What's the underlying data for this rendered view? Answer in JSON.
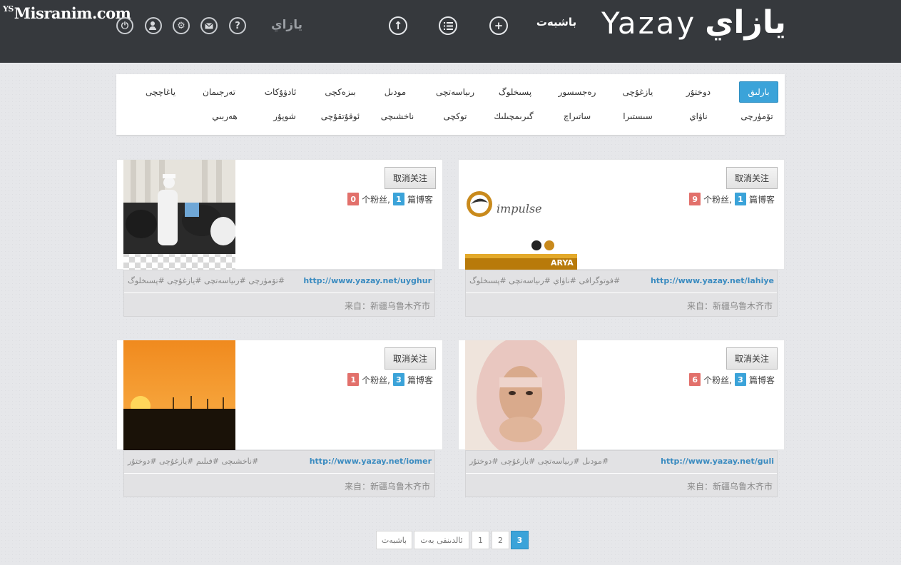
{
  "watermark": {
    "cap": "YS",
    "text": "Misranim.com"
  },
  "header": {
    "logo_uyghur": "يازاي",
    "logo_latin": "Yazay",
    "home_link": "باشبەت",
    "user_name": "يازاي",
    "icons": [
      "power-icon",
      "add-user-icon",
      "settings-icon",
      "mail-icon",
      "help-icon",
      "upload-icon",
      "list-icon",
      "plus-icon"
    ]
  },
  "categories": [
    {
      "label": "بارلىق",
      "active": true
    },
    {
      "label": "دوختۇر"
    },
    {
      "label": "يازغۇچى"
    },
    {
      "label": "رەجسسور"
    },
    {
      "label": "پسىخلوگ"
    },
    {
      "label": "رىياسەتچى"
    },
    {
      "label": "مودىل"
    },
    {
      "label": "بىزەكچى"
    },
    {
      "label": "ئادۋۇكات"
    },
    {
      "label": "تەرجىمان"
    },
    {
      "label": "ياغاچچى"
    },
    {
      "label": "تۆمۈرچى"
    },
    {
      "label": "ناۋاي"
    },
    {
      "label": "سىستىرا"
    },
    {
      "label": "ساتىراچ"
    },
    {
      "label": "گىرىمچىلىك"
    },
    {
      "label": "توكچى"
    },
    {
      "label": "ناخشىچى"
    },
    {
      "label": "ئوقۇتقۇچى"
    },
    {
      "label": "شوپۇر"
    },
    {
      "label": "ھەربىي"
    }
  ],
  "cards": [
    {
      "image": "praying-children",
      "follow_button": "取消关注",
      "fans": "0",
      "fans_label": "个粉丝,",
      "blogs": "1",
      "blogs_label": "篇博客",
      "url": "http://www.yazay.net/uyghur",
      "tags": "#تۆمۈرچى #رىياسەتچى #يازغۇچى #پسىخلوگ",
      "from": "来自：新疆乌鲁木齐市"
    },
    {
      "image": "impulse-logo",
      "follow_button": "取消关注",
      "fans": "9",
      "fans_label": "个粉丝,",
      "blogs": "1",
      "blogs_label": "篇博客",
      "url": "http://www.yazay.net/lahiye",
      "tags": "#فوتوگرافى #ناۋاي #رىياسەتچى #پسىخلوگ",
      "from": "来自：新疆乌鲁木齐市",
      "logo_text": "impulse",
      "banner_text": "ARYA"
    },
    {
      "image": "sunset",
      "follow_button": "取消关注",
      "fans": "1",
      "fans_label": "个粉丝,",
      "blogs": "3",
      "blogs_label": "篇博客",
      "url": "http://www.yazay.net/iomer",
      "tags": "#ناخشىچى #فىلىم #يازغۇچى #دوختۇر",
      "from": "来自：新疆乌鲁木齐市"
    },
    {
      "image": "woman-in-hijab",
      "follow_button": "取消关注",
      "fans": "6",
      "fans_label": "个粉丝,",
      "blogs": "3",
      "blogs_label": "篇博客",
      "url": "http://www.yazay.net/guli",
      "tags": "#مودىل #رىياسەتچى #يازغۇچى #دوختۇر",
      "from": "来自：新疆乌鲁木齐市"
    }
  ],
  "pagination": {
    "first": "باشبەت",
    "prev": "ئالدىنقى بەت",
    "pages": [
      "1",
      "2",
      "3"
    ],
    "current": "3"
  },
  "colors": {
    "topbar": "#36393d",
    "accent": "#3ba3d9",
    "badge_red": "#e2706b",
    "link": "#3a8bc0"
  }
}
